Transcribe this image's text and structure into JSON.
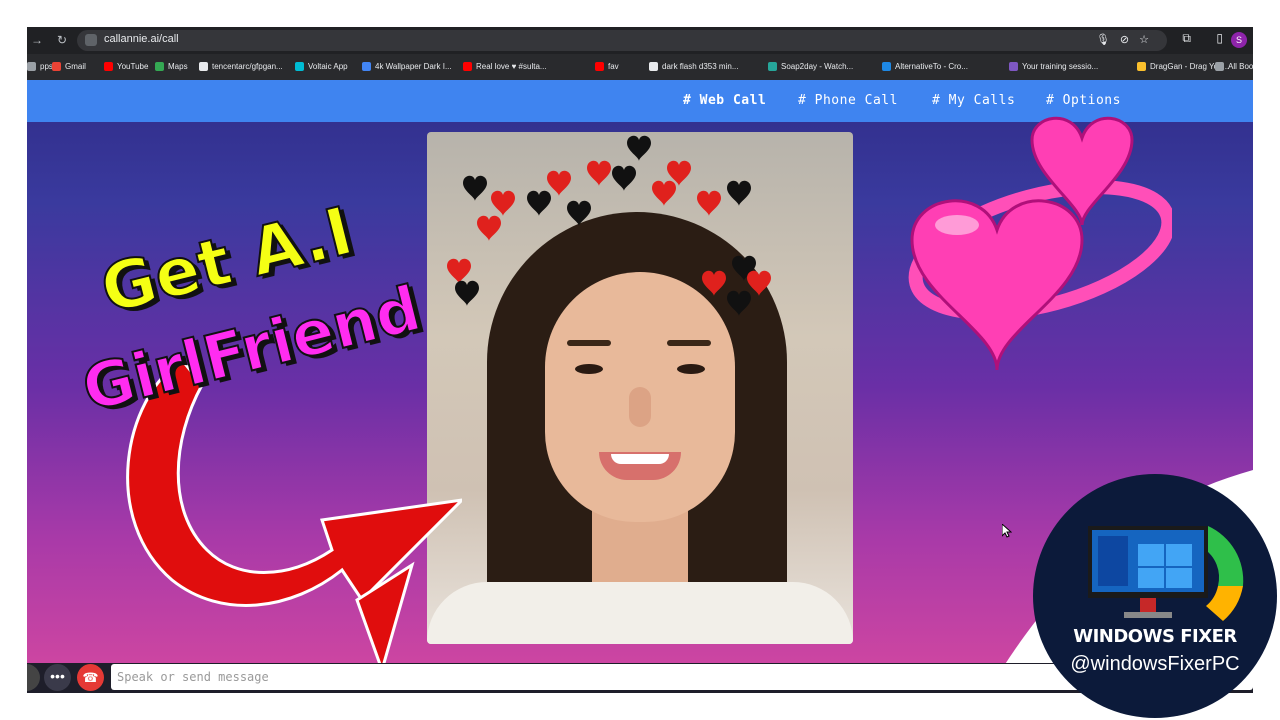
{
  "browser": {
    "url": "callannie.ai/call",
    "profile_initial": "S",
    "bookmarks": [
      {
        "label": "pps",
        "color": "#9aa0a6"
      },
      {
        "label": "Gmail",
        "color": "#ea4335"
      },
      {
        "label": "YouTube",
        "color": "#ff0000"
      },
      {
        "label": "Maps",
        "color": "#34a853"
      },
      {
        "label": "tencentarc/gfpgan...",
        "color": "#e8eaed"
      },
      {
        "label": "Voltaic App",
        "color": "#00bcd4"
      },
      {
        "label": "4k Wallpaper Dark I...",
        "color": "#4285f4"
      },
      {
        "label": "Real love ♥ #sulta...",
        "color": "#ff0000"
      },
      {
        "label": "fav",
        "color": "#ff0000"
      },
      {
        "label": "dark flash d353 min...",
        "color": "#e8eaed"
      },
      {
        "label": "Soap2day - Watch...",
        "color": "#26a69a"
      },
      {
        "label": "AlternativeTo - Cro...",
        "color": "#1e88e5"
      },
      {
        "label": "Your training sessio...",
        "color": "#7e57c2"
      },
      {
        "label": "DragGan - Drag You...",
        "color": "#fbc02d"
      },
      {
        "label": "All Bookm",
        "color": "#9aa0a6"
      }
    ]
  },
  "nav": {
    "items": [
      {
        "label": "# Web Call",
        "active": true
      },
      {
        "label": "# Phone Call",
        "active": false
      },
      {
        "label": "# My Calls",
        "active": false
      },
      {
        "label": "# Options",
        "active": false
      }
    ]
  },
  "overlay": {
    "line1": "Get A.I",
    "line2": "GirlFriend"
  },
  "chat": {
    "placeholder": "Speak or send message"
  },
  "badge": {
    "title": "WINDOWS FIXER",
    "handle": "@windowsFixerPC"
  },
  "colors": {
    "navbar": "#3f84f0",
    "hangup": "#e53935",
    "heart": "#ff3fb4"
  }
}
